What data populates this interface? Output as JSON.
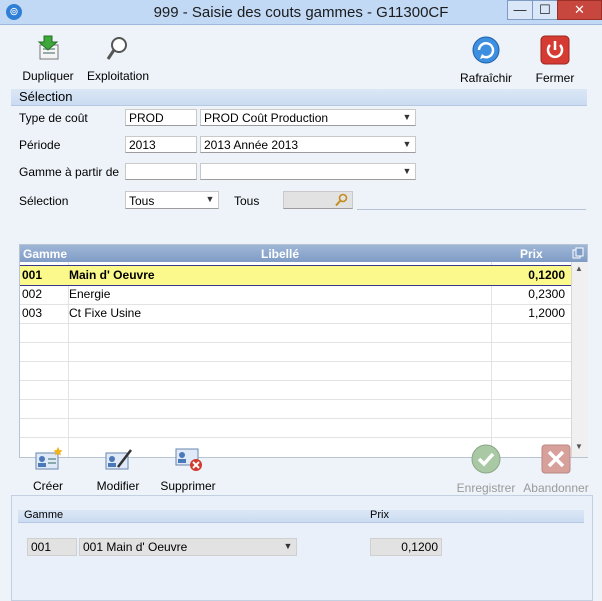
{
  "window": {
    "title": "999 - Saisie des couts gammes - G11300CF",
    "minimize": "—",
    "maximize": "☐",
    "close": "✕"
  },
  "toolbar": {
    "duplicate": "Dupliquer",
    "exploitation": "Exploitation",
    "refresh": "Rafraîchir",
    "close": "Fermer"
  },
  "selection": {
    "header": "Sélection",
    "cost_type": {
      "label": "Type de coût",
      "code": "PROD",
      "value": "PROD  Coût Production"
    },
    "period": {
      "label": "Période",
      "code": "2013",
      "value": "2013    Année 2013"
    },
    "range_from": {
      "label": "Gamme à partir de",
      "code": "",
      "value": ""
    },
    "filter": {
      "label": "Sélection",
      "value": "Tous",
      "label2": "Tous",
      "field2": ""
    }
  },
  "grid": {
    "columns": [
      "Gamme",
      "Libellé",
      "Prix"
    ],
    "rows": [
      {
        "code": "001",
        "label": "Main d' Oeuvre",
        "price": "0,1200"
      },
      {
        "code": "002",
        "label": "Energie",
        "price": "0,2300"
      },
      {
        "code": "003",
        "label": "Ct Fixe Usine",
        "price": "1,2000"
      }
    ]
  },
  "actions": {
    "create": "Créer",
    "modify": "Modifier",
    "delete": "Supprimer",
    "save": "Enregistrer",
    "abandon": "Abandonner"
  },
  "detail": {
    "gamme_label": "Gamme",
    "price_label": "Prix",
    "gamme_code": "001",
    "gamme_value": "001   Main d' Oeuvre",
    "price": "0,1200"
  },
  "colors": {
    "selected_row": "#fbf98c",
    "grid_header": "#7f9cc6",
    "close_button": "#c7463d"
  }
}
